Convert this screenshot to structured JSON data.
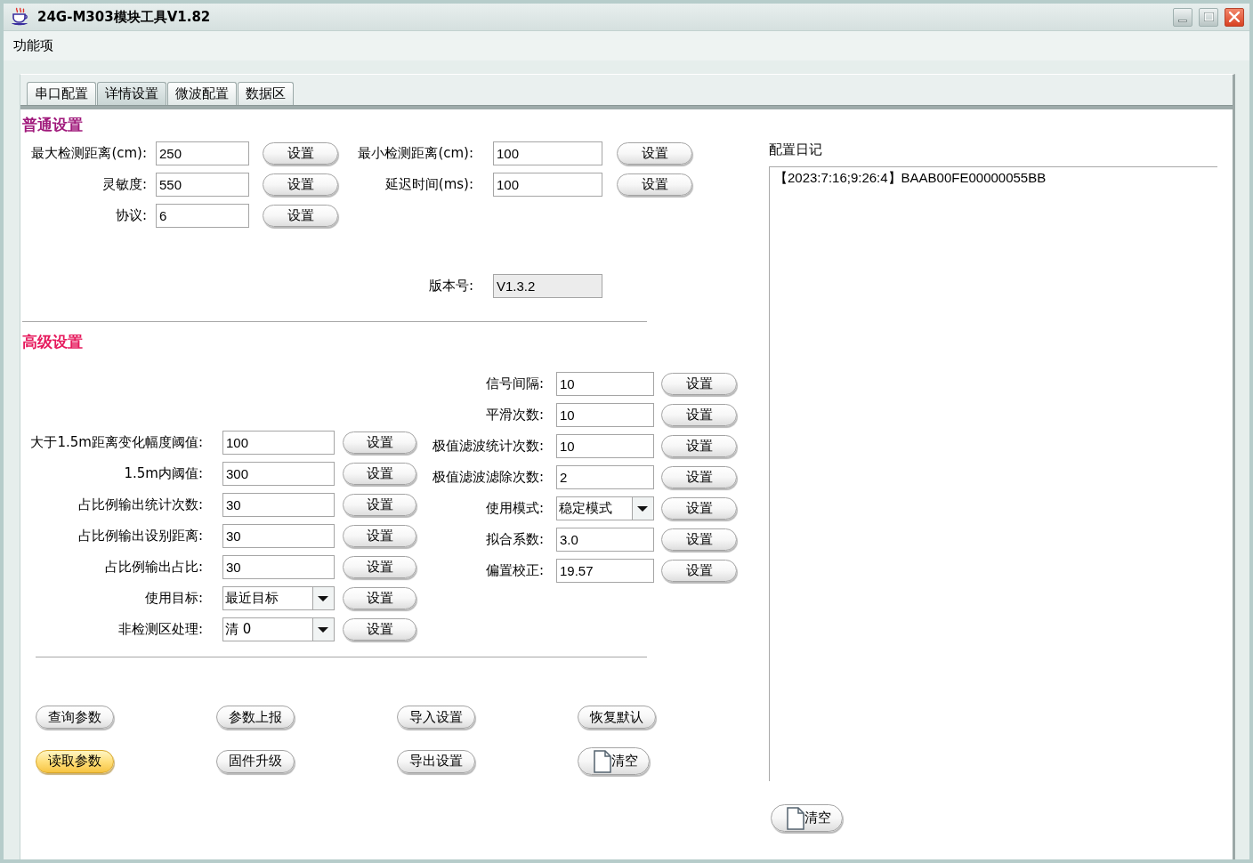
{
  "window": {
    "title": "24G-M303模块工具V1.82"
  },
  "menu": [
    {
      "label": "功能项"
    }
  ],
  "tabs": [
    {
      "label": "串口配置",
      "selected": false
    },
    {
      "label": "详情设置",
      "selected": true
    },
    {
      "label": "微波配置",
      "selected": false
    },
    {
      "label": "数据区",
      "selected": false
    }
  ],
  "general_settings": {
    "heading": "普通设置",
    "fields": [
      {
        "label": "最大检测距离(cm):",
        "kind": "input",
        "value": "250",
        "button": "设置"
      },
      {
        "label": "最小检测距离(cm):",
        "kind": "input",
        "value": "100",
        "button": "设置"
      },
      {
        "label": "灵敏度:",
        "kind": "input",
        "value": "550",
        "button": "设置"
      },
      {
        "label": "延迟时间(ms):",
        "kind": "input",
        "value": "100",
        "button": "设置"
      },
      {
        "label": "协议:",
        "kind": "input",
        "value": "6",
        "button": "设置"
      }
    ],
    "version": {
      "label": "版本号:",
      "value": "V1.3.2",
      "disabled": true
    }
  },
  "advanced_settings": {
    "heading": "高级设置",
    "left_column": [
      {
        "label": "大于1.5m距离变化幅度阈值:",
        "kind": "input",
        "value": "100",
        "button": "设置"
      },
      {
        "label": "1.5m内阈值:",
        "kind": "input",
        "value": "300",
        "button": "设置"
      },
      {
        "label": "占比例输出统计次数:",
        "kind": "input",
        "value": "30",
        "button": "设置"
      },
      {
        "label": "占比例输出设别距离:",
        "kind": "input",
        "value": "30",
        "button": "设置"
      },
      {
        "label": "占比例输出占比:",
        "kind": "input",
        "value": "30",
        "button": "设置"
      },
      {
        "label": "使用目标:",
        "kind": "select",
        "value": "最近目标",
        "button": "设置"
      },
      {
        "label": "非检测区处理:",
        "kind": "select",
        "value": "清 0",
        "button": "设置"
      }
    ],
    "right_column": [
      {
        "label": "信号间隔:",
        "kind": "input",
        "value": "10",
        "button": "设置"
      },
      {
        "label": "平滑次数:",
        "kind": "input",
        "value": "10",
        "button": "设置"
      },
      {
        "label": "极值滤波统计次数:",
        "kind": "input",
        "value": "10",
        "button": "设置"
      },
      {
        "label": "极值滤波滤除次数:",
        "kind": "input",
        "value": "2",
        "button": "设置"
      },
      {
        "label": "使用模式:",
        "kind": "select",
        "value": "稳定模式",
        "button": "设置"
      },
      {
        "label": "拟合系数:",
        "kind": "input",
        "value": "3.0",
        "button": "设置"
      },
      {
        "label": "偏置校正:",
        "kind": "input",
        "value": "19.57",
        "button": "设置"
      }
    ]
  },
  "actions": [
    {
      "label": "查询参数",
      "kind": "plain",
      "focused": false
    },
    {
      "label": "参数上报",
      "kind": "plain",
      "focused": false
    },
    {
      "label": "导入设置",
      "kind": "plain",
      "focused": false
    },
    {
      "label": "恢复默认",
      "kind": "plain",
      "focused": false
    },
    {
      "label": "读取参数",
      "kind": "plain",
      "focused": true
    },
    {
      "label": "固件升级",
      "kind": "plain",
      "focused": false
    },
    {
      "label": "导出设置",
      "kind": "plain",
      "focused": false
    },
    {
      "label": "清空",
      "kind": "icon",
      "focused": false
    }
  ],
  "log": {
    "label": "配置日记",
    "lines": [
      "【2023:7:16;9:26:4】BAAB00FE00000055BB"
    ],
    "clear_button": {
      "label": "清空"
    }
  }
}
